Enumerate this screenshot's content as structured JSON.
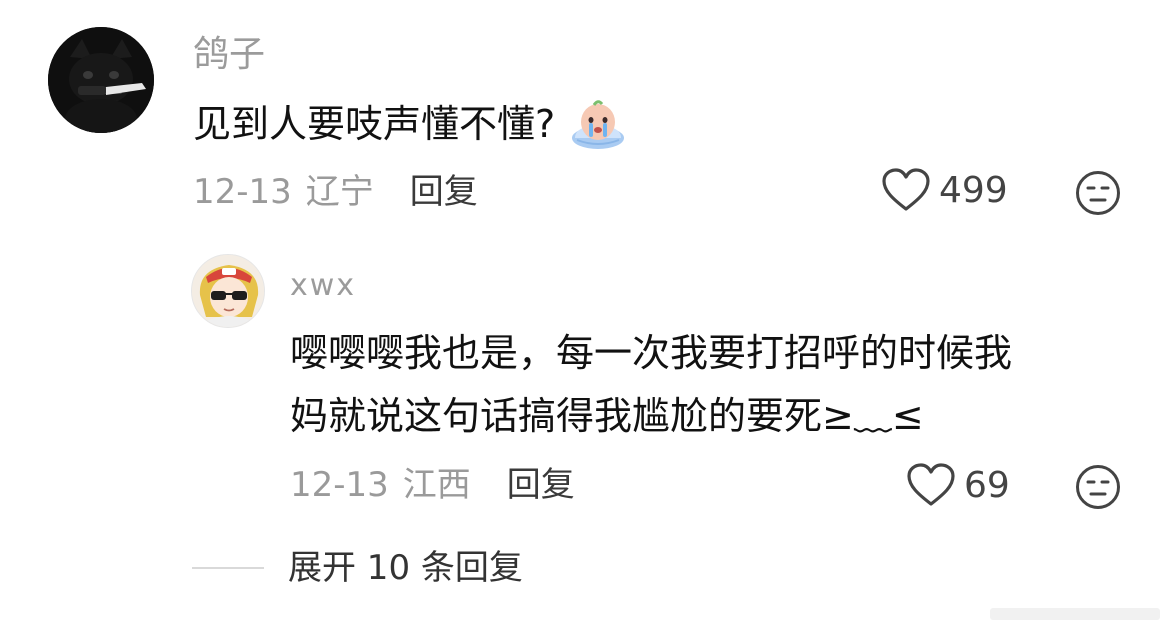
{
  "comment": {
    "username": "鸽子",
    "text": "见到人要吱声懂不懂?",
    "emoji_icon": "crying-face-emoji",
    "date": "12-13",
    "region": "辽宁",
    "reply_label": "回复",
    "likes": "499"
  },
  "reply": {
    "username": "xwx",
    "lines": [
      "嘤嘤嘤我也是，每一次我要打招呼的时候我",
      "妈就说这句话搞得我尴尬的要死≥﹏≤"
    ],
    "date": "12-13",
    "region": "江西",
    "reply_label": "回复",
    "likes": "69"
  },
  "expand_label": "展开 10 条回复",
  "colors": {
    "text": "#111111",
    "meta": "#9a9a9a",
    "background": "#ffffff"
  }
}
